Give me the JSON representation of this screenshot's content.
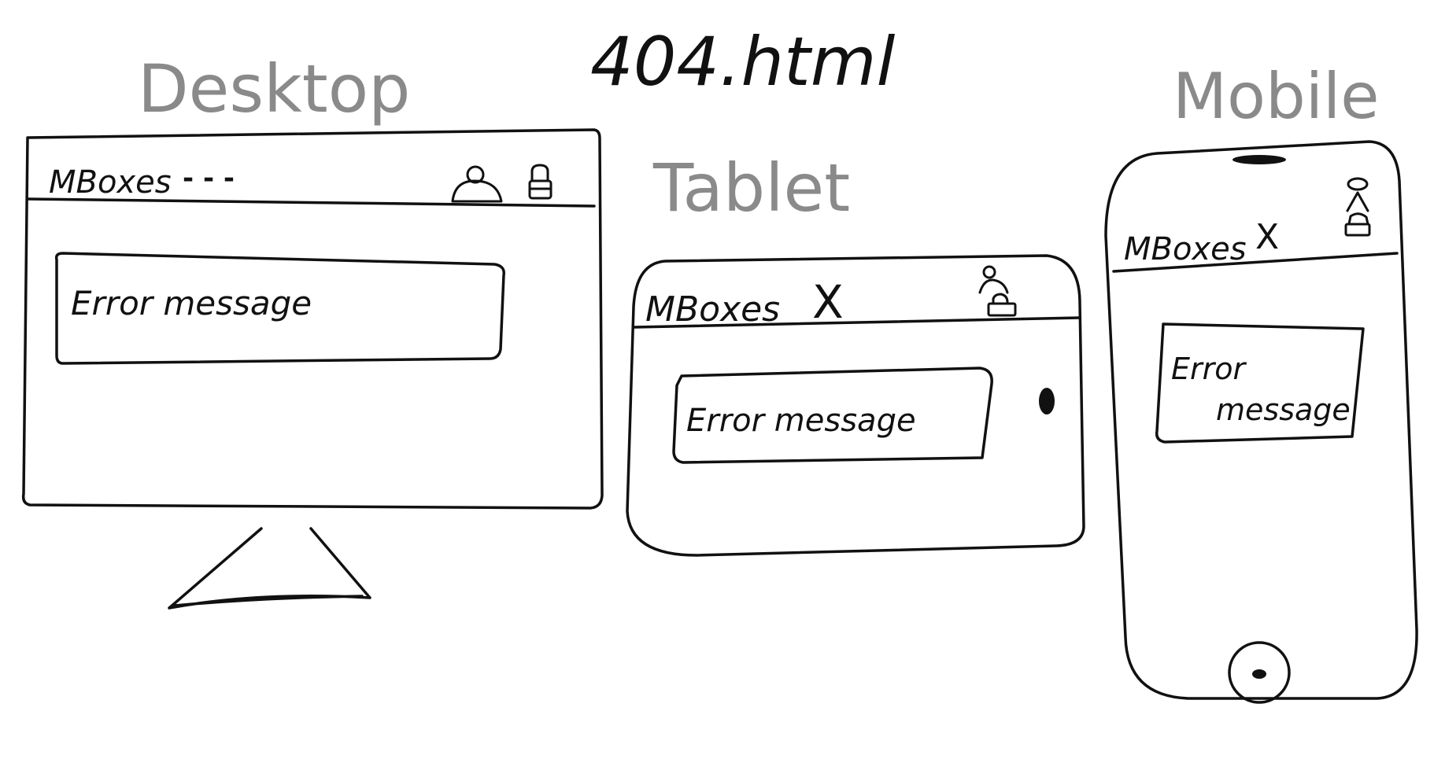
{
  "page_title": "404.html",
  "colors": {
    "ink": "#111111",
    "label": "#8a8a8a",
    "background": "#ffffff"
  },
  "desktop": {
    "label": "Desktop",
    "brand": "MBoxes",
    "nav_placeholder": "- - -",
    "icons": [
      "user-icon",
      "lock-icon"
    ],
    "error_message": "Error message"
  },
  "tablet": {
    "label": "Tablet",
    "brand": "MBoxes",
    "close_glyph": "X",
    "icons": [
      "user-icon",
      "lock-icon"
    ],
    "error_message": "Error message"
  },
  "mobile": {
    "label": "Mobile",
    "brand": "MBoxes",
    "close_glyph": "X",
    "icons": [
      "user-icon",
      "lock-icon"
    ],
    "error_message_line1": "Error",
    "error_message_line2": "message"
  }
}
